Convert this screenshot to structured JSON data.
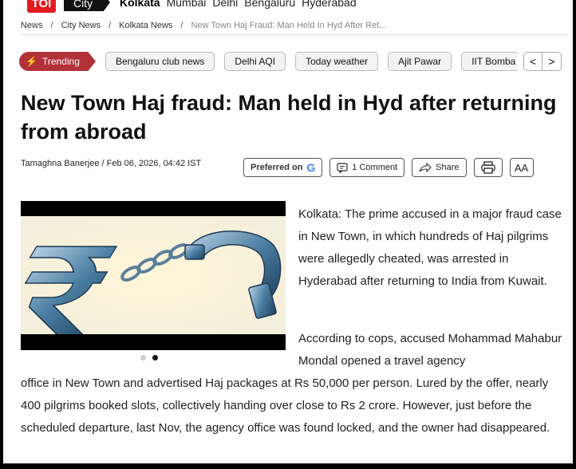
{
  "nav": {
    "logo": "TOI",
    "section": "City",
    "cities": [
      "Kolkata",
      "Mumbai",
      "Delhi",
      "Bengaluru",
      "Hyderabad"
    ]
  },
  "breadcrumb": {
    "items": [
      "News",
      "City News",
      "Kolkata News"
    ],
    "current": "New Town Haj Fraud: Man Held In Hyd After Ret..."
  },
  "trending": {
    "label": "Trending",
    "chips": [
      "Bengaluru club news",
      "Delhi AQI",
      "Today weather",
      "Ajit Pawar",
      "IIT Bomba"
    ],
    "prev": "<",
    "next": ">"
  },
  "article": {
    "headline": "New Town Haj fraud: Man held in Hyd after returning from abroad",
    "byline": "Tamaghna Banerjee / Feb 06, 2026, 04:42 IST",
    "actions": {
      "preferred": "Preferred on",
      "google_letter": "G",
      "comment": "1 Comment",
      "share": "Share",
      "font_size": "AA"
    },
    "para1": "Kolkata: The prime accused in a major fraud case in New Town, in which hundreds of Haj pilgrims were allegedly cheated, was arrested in Hyderabad after returning to India from Kuwait.",
    "para2_right": "According to cops, accused Mohammad Mahabur Mondal opened a travel agency",
    "para2_full": "office in New Town and advertised Haj packages at Rs 50,000 per person. Lured by the offer, nearly 400 pilgrims booked slots, collectively handing over close to Rs 2 crore. However, just before the scheduled departure, last Nov, the agency office was found locked, and the owner had disappeared."
  },
  "carousel": {
    "total": 2,
    "active": 2
  },
  "icons": {
    "trending": "flame-icon",
    "comment": "comment-icon",
    "share": "share-icon",
    "print": "print-icon"
  },
  "colors": {
    "brand_red": "#e21b22",
    "trending_bg": "#b3323a"
  }
}
